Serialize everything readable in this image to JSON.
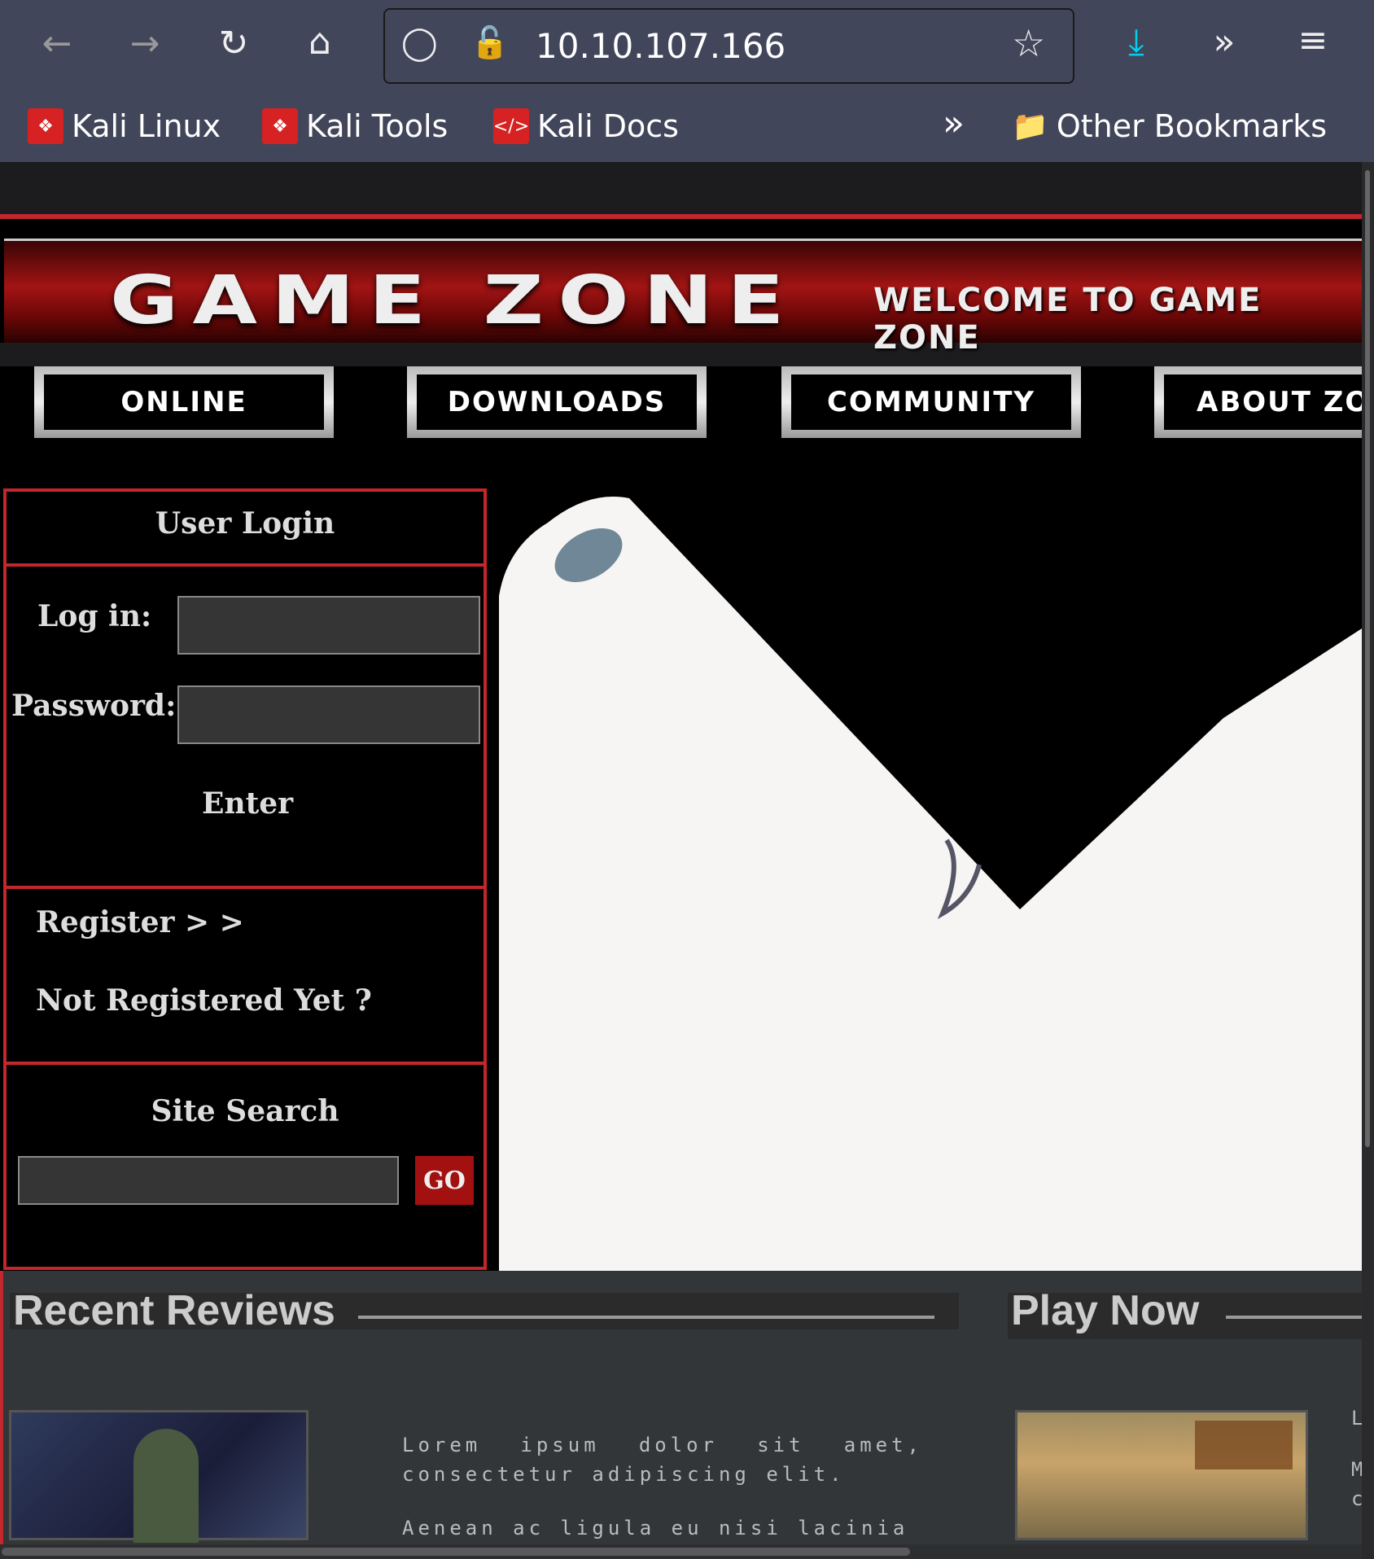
{
  "browser": {
    "url": "10.10.107.166",
    "bookmarks": [
      {
        "label": "Kali Linux"
      },
      {
        "label": "Kali Tools"
      },
      {
        "label": "Kali Docs"
      }
    ],
    "other_bookmarks": "Other Bookmarks"
  },
  "site": {
    "logo": "GAME ZONE",
    "welcome": "WELCOME TO GAME ZONE",
    "nav": [
      "ONLINE",
      "DOWNLOADS",
      "COMMUNITY",
      "ABOUT ZO"
    ],
    "login": {
      "title": "User Login",
      "login_label": "Log in:",
      "password_label": "Password:",
      "enter": "Enter",
      "register": "Register > >",
      "not_registered": "Not Registered Yet ?",
      "search_title": "Site Search",
      "go": "GO"
    },
    "recent_reviews": "Recent Reviews",
    "play_now": "Play Now",
    "review_text_1": "Lorem ipsum dolor sit amet, consectetur adipiscing elit.",
    "review_text_2": "Aenean ac ligula eu nisi lacinia",
    "side_letters": [
      "L",
      "M",
      "c"
    ]
  }
}
